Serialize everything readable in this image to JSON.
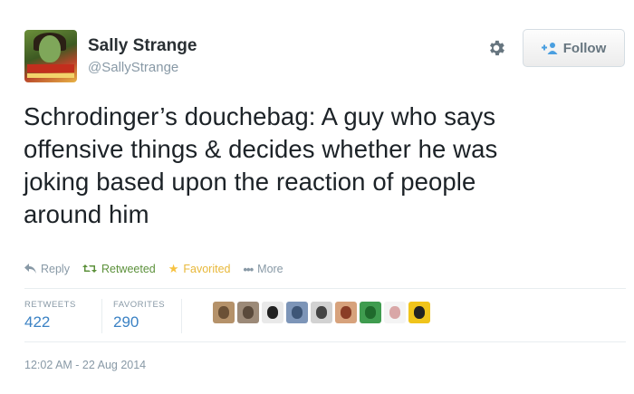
{
  "user": {
    "name": "Sally Strange",
    "handle": "@SallyStrange"
  },
  "follow_button": {
    "label": "Follow"
  },
  "tweet": {
    "lines": [
      "Schrodinger’s douchebag: A guy who says",
      "offensive things & decides whether he was",
      "joking based upon the reaction of people",
      "around him"
    ]
  },
  "actions": {
    "reply": "Reply",
    "retweeted": "Retweeted",
    "favorited": "Favorited",
    "more": "More"
  },
  "stats": {
    "retweets_label": "RETWEETS",
    "retweets": "422",
    "favorites_label": "FAVORITES",
    "favorites": "290"
  },
  "favoriter_avatars": [
    {
      "color": "#b5926a",
      "accent": "#6b5136"
    },
    {
      "color": "#9c8a78",
      "accent": "#5a4a3b"
    },
    {
      "color": "#e9e9e9",
      "accent": "#222222"
    },
    {
      "color": "#7d95b8",
      "accent": "#3e5677"
    },
    {
      "color": "#d2d2d2",
      "accent": "#444444"
    },
    {
      "color": "#d7a27c",
      "accent": "#8a3d26"
    },
    {
      "color": "#3f9c4f",
      "accent": "#1f6a2c"
    },
    {
      "color": "#f4f4f4",
      "accent": "#d9a7a7"
    },
    {
      "color": "#f0c41b",
      "accent": "#222222"
    }
  ],
  "timestamp": "12:02 AM - 22 Aug 2014",
  "colors": {
    "link_blue": "#3b82c4",
    "retweet_green": "#5c913b",
    "favorite_gold": "#f7c240",
    "muted": "#8899a6"
  }
}
